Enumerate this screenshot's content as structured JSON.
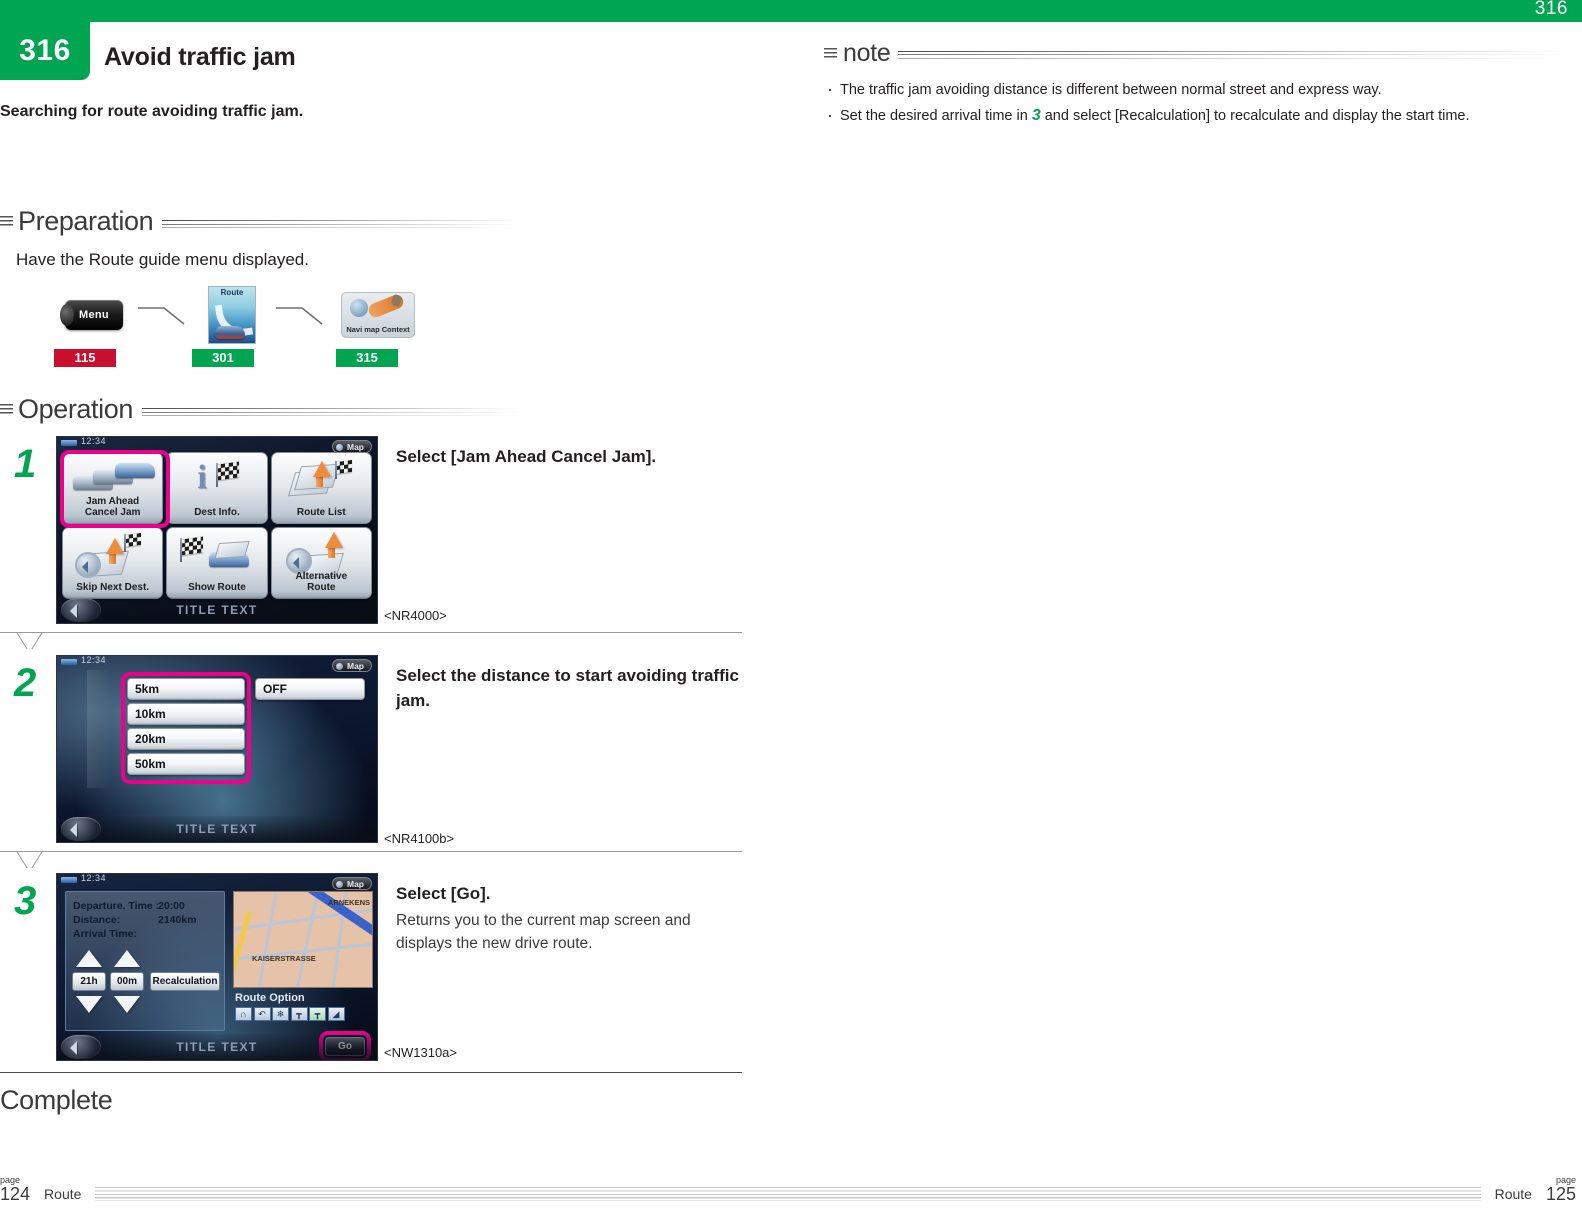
{
  "header": {
    "top_page_number": "316",
    "chapter_number": "316",
    "chapter_title": "Avoid traffic jam",
    "lead": "Searching for route avoiding traffic jam."
  },
  "note": {
    "label": "note",
    "items": [
      "The traffic jam avoiding distance is different between normal street and express way.",
      "Set the desired arrival time in "
    ],
    "item2_step_ref": "3",
    "item2_tail": " and select [Recalculation] to recalculate and display the start time."
  },
  "preparation": {
    "label": "Preparation",
    "text": "Have the Route guide menu displayed.",
    "flow": [
      {
        "icon": "menu-button-icon",
        "caption": "Menu",
        "badge": "115",
        "badge_color": "#c8102e"
      },
      {
        "icon": "route-screen-icon",
        "caption": "Route",
        "badge": "301",
        "badge_color": "#00a551"
      },
      {
        "icon": "navi-map-context-icon",
        "caption": "Navi map Context",
        "badge": "315",
        "badge_color": "#00a551"
      }
    ]
  },
  "operation": {
    "label": "Operation",
    "steps": [
      {
        "number": "1",
        "instruction_title": "Select [Jam Ahead Cancel Jam].",
        "instruction_body": "",
        "screen_code": "<NR4000>",
        "screen": {
          "status_time": "12:34",
          "map_button": "Map",
          "title_text": "TITLE TEXT",
          "tiles": [
            {
              "label_line1": "Jam Ahead",
              "label_line2": "Cancel Jam",
              "highlighted": true
            },
            {
              "label_line1": "Dest Info.",
              "label_line2": "",
              "highlighted": false
            },
            {
              "label_line1": "Route List",
              "label_line2": "",
              "highlighted": false
            },
            {
              "label_line1": "Skip Next Dest.",
              "label_line2": "",
              "highlighted": false
            },
            {
              "label_line1": "Show Route",
              "label_line2": "",
              "highlighted": false
            },
            {
              "label_line1": "Alternative",
              "label_line2": "Route",
              "highlighted": false
            }
          ]
        }
      },
      {
        "number": "2",
        "instruction_title": "Select the distance to start avoiding traffic jam.",
        "instruction_body": "",
        "screen_code": "<NR4100b>",
        "screen": {
          "status_time": "12:34",
          "map_button": "Map",
          "title_text": "TITLE TEXT",
          "distances": [
            "5km",
            "10km",
            "20km",
            "50km"
          ],
          "off_button": "OFF"
        }
      },
      {
        "number": "3",
        "instruction_title": "Select [Go].",
        "instruction_body": "Returns you to the current map screen and displays the new drive route.",
        "screen_code": "<NW1310a>",
        "screen": {
          "status_time": "12:34",
          "map_button": "Map",
          "title_text": "TITLE TEXT",
          "departure_label": "Departure. Time :",
          "departure_value": "20:00",
          "distance_label": "Distance:",
          "distance_value": "2140km",
          "arrival_label": "Arrival Time:",
          "arrival_value": "",
          "hour_value": "21h",
          "minute_value": "00m",
          "recalculation_label": "Recalculation",
          "route_option_label": "Route Option",
          "go_label": "Go",
          "map_labels": [
            "ARNEKENS",
            "KAISERSTRASSE"
          ]
        }
      }
    ]
  },
  "complete_label": "Complete",
  "footer": {
    "left_page_word": "page",
    "left_page_number": "124",
    "left_section": "Route",
    "right_section": "Route",
    "right_page_word": "page",
    "right_page_number": "125"
  },
  "colors": {
    "brand_green": "#00a551",
    "badge_red": "#c8102e",
    "highlight_pink": "#ec008c"
  }
}
